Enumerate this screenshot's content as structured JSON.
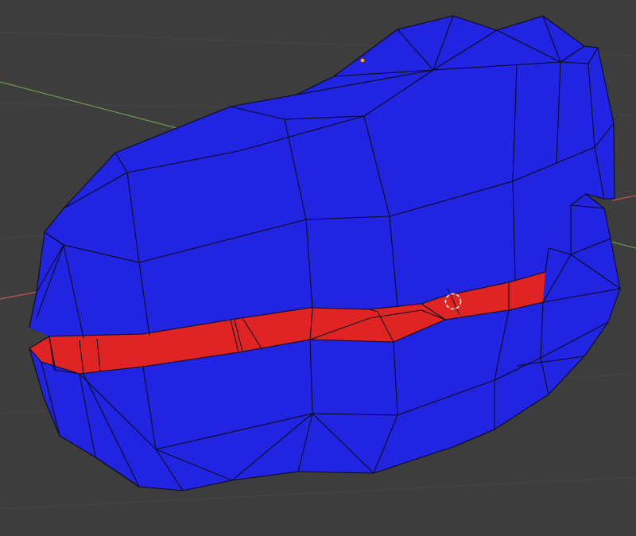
{
  "app": "3D viewport",
  "viewport": {
    "background_color": "#3d3d3d",
    "grid_line_color": "#444444",
    "x_axis_color": "#b85a5a",
    "y_axis_color": "#7aa05a"
  },
  "mesh": {
    "upper_face_color": "#2124e0",
    "lower_face_color": "#2124e0",
    "band_face_color": "#e02424",
    "edge_color": "#0b0b1a",
    "origin_dot_color": "#f5a623"
  },
  "icons": {
    "cursor": "3d-cursor-icon",
    "origin": "object-origin-icon"
  }
}
